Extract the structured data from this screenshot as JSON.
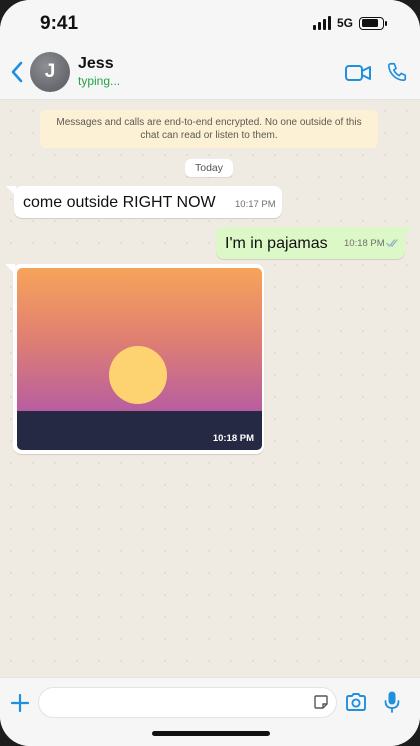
{
  "status_bar": {
    "time": "9:41",
    "network": "5G"
  },
  "header": {
    "contact_name": "Jess",
    "contact_initial": "J",
    "contact_status": "typing...",
    "icons": [
      "chevron-left-icon",
      "video-camera-icon",
      "phone-icon"
    ],
    "accent_color": "#1f8fe0"
  },
  "chat": {
    "encryption_notice": "Messages and calls are end-to-end encrypted. No one outside of this chat can read or listen to them.",
    "date_separator": "Today",
    "messages": [
      {
        "direction": "incoming",
        "type": "text",
        "text": "come outside RIGHT NOW",
        "time": "10:17 PM"
      },
      {
        "direction": "outgoing",
        "type": "text",
        "text": "I'm in pajamas",
        "time": "10:18 PM",
        "status": "read"
      },
      {
        "direction": "incoming",
        "type": "image",
        "image": "sunset",
        "time": "10:18 PM"
      }
    ],
    "colors": {
      "incoming_bubble": "#ffffff",
      "outgoing_bubble": "#dcf8c6",
      "background": "#efeae2"
    }
  },
  "input_bar": {
    "message_value": "",
    "icons": [
      "plus-icon",
      "sticker-icon",
      "camera-icon",
      "microphone-icon"
    ]
  }
}
